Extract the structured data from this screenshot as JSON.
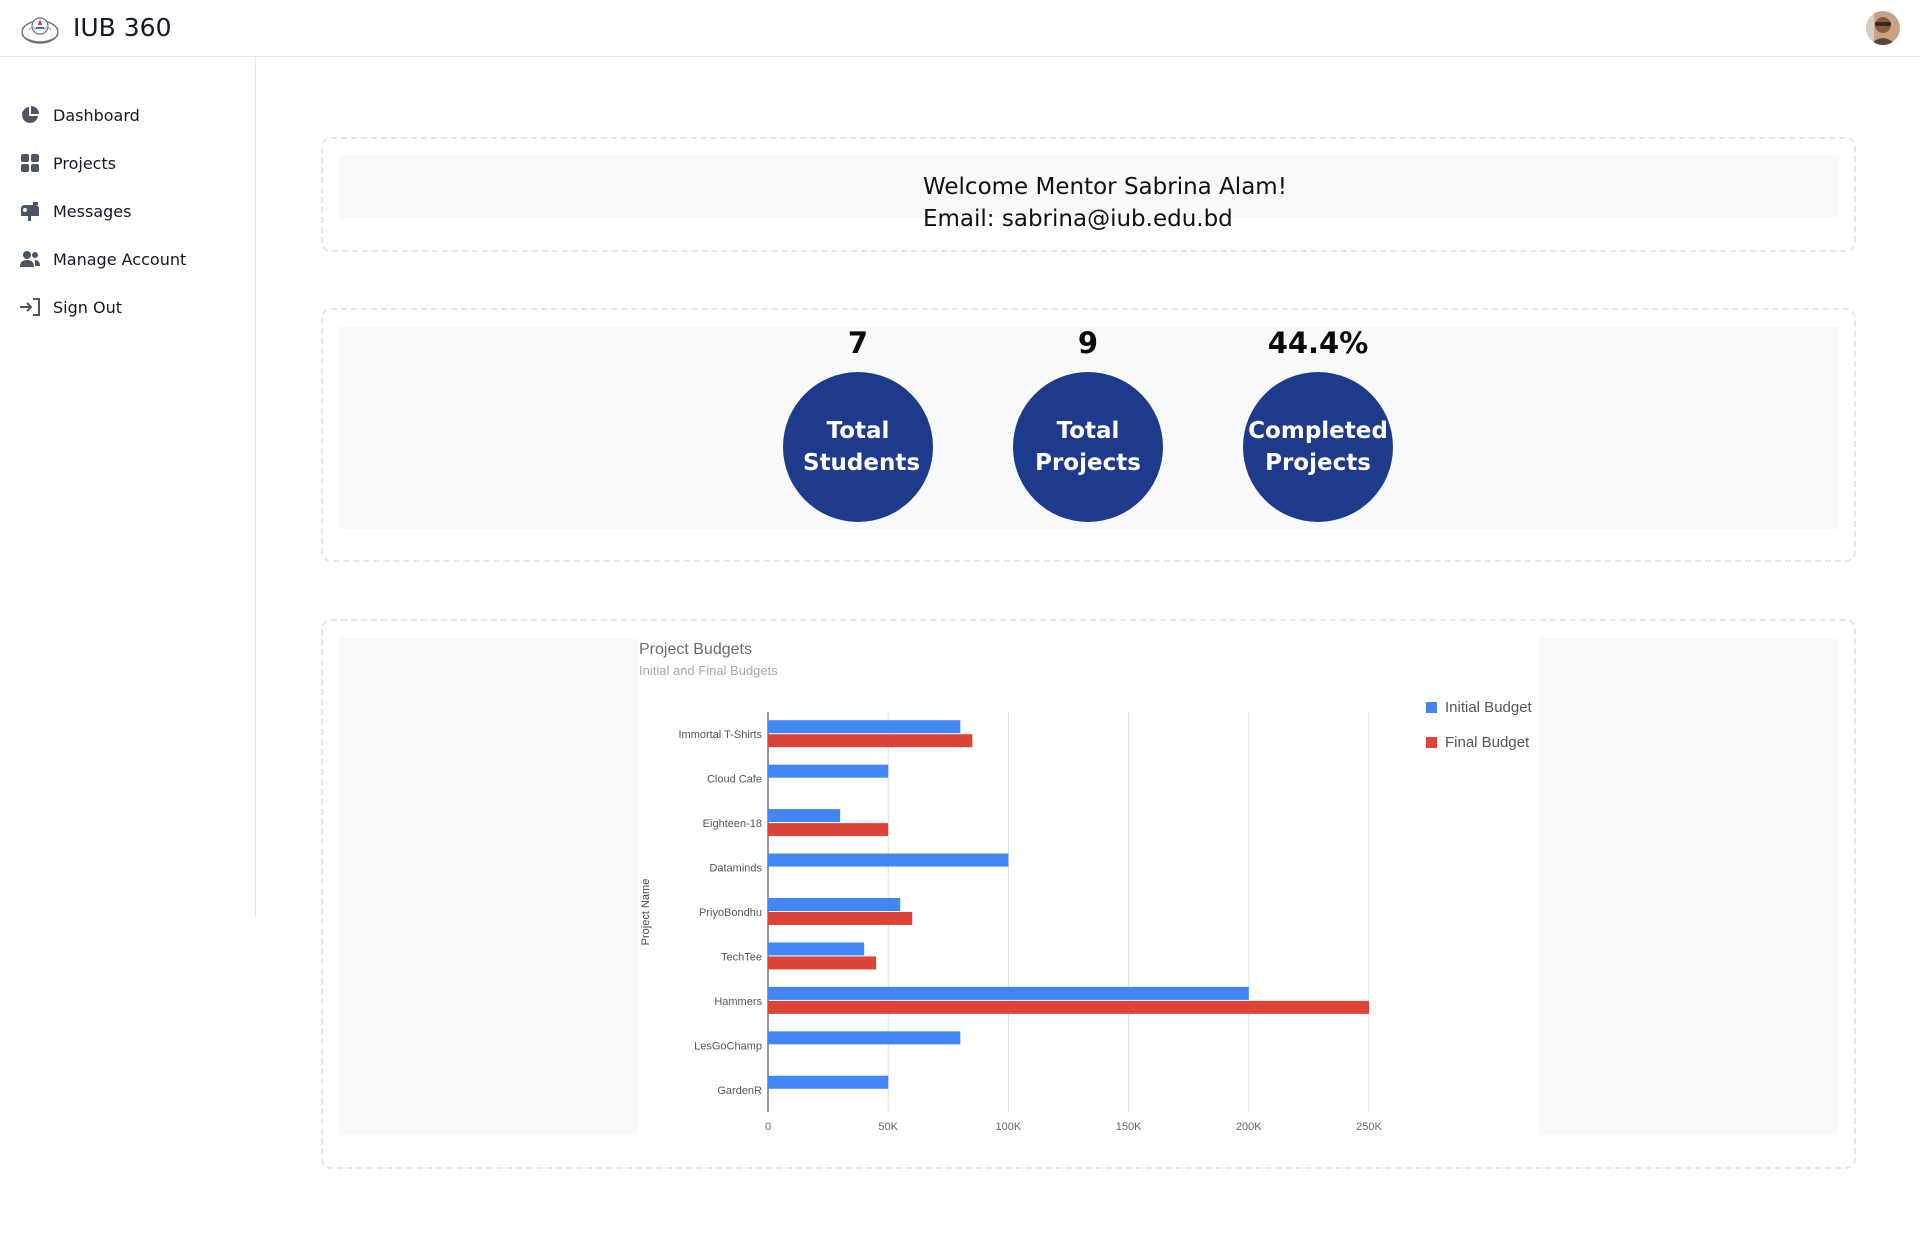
{
  "app": {
    "title": "IUB 360"
  },
  "sidebar": {
    "items": [
      {
        "label": "Dashboard",
        "icon": "pie-chart-icon"
      },
      {
        "label": "Projects",
        "icon": "grid-icon"
      },
      {
        "label": "Messages",
        "icon": "mailbox-icon"
      },
      {
        "label": "Manage Account",
        "icon": "users-icon"
      },
      {
        "label": "Sign Out",
        "icon": "sign-out-icon"
      }
    ]
  },
  "welcome": {
    "line1": "Welcome Mentor Sabrina Alam!",
    "line2": "Email: sabrina@iub.edu.bd"
  },
  "stats": [
    {
      "value": "7",
      "label": "Total Students"
    },
    {
      "value": "9",
      "label": "Total Projects"
    },
    {
      "value": "44.4%",
      "label": "Completed Projects"
    }
  ],
  "colors": {
    "accent": "#1e3a8a",
    "initial_budget": "#4285f4",
    "final_budget": "#db4437"
  },
  "chart_data": {
    "type": "bar",
    "orientation": "horizontal",
    "title": "Project Budgets",
    "subtitle": "Initial and Final Budgets",
    "ylabel": "Project Name",
    "xlabel": "",
    "categories": [
      "Immortal T-Shirts",
      "Cloud Cafe",
      "Eighteen-18",
      "Dataminds",
      "PriyoBondhu",
      "TechTee",
      "Hammers",
      "LesGoChamp",
      "GardenR"
    ],
    "series": [
      {
        "name": "Initial Budget",
        "values": [
          80000,
          50000,
          30000,
          100000,
          55000,
          40000,
          200000,
          80000,
          50000
        ]
      },
      {
        "name": "Final Budget",
        "values": [
          85000,
          null,
          50000,
          null,
          60000,
          45000,
          250000,
          null,
          null
        ]
      }
    ],
    "xlim": [
      0,
      250000
    ],
    "xticks": [
      "0",
      "50K",
      "100K",
      "150K",
      "200K",
      "250K"
    ],
    "grid": true,
    "legend": "right"
  }
}
